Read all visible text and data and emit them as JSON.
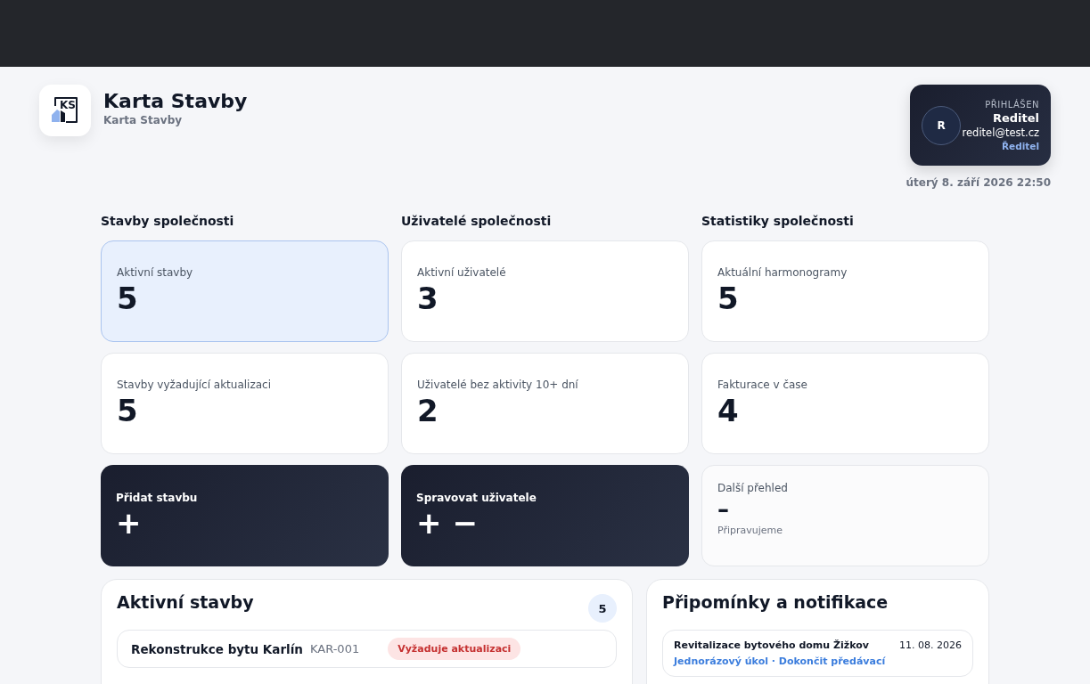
{
  "brand": {
    "logo": "KS",
    "title": "Karta Stavby",
    "subtitle": "Karta Stavby"
  },
  "user": {
    "avatar": "R",
    "label": "PŘIHLÁŠEN",
    "name": "Reditel",
    "email": "reditel@test.cz",
    "role": "Ředitel"
  },
  "datetime": "úterý 8. září 2026 22:50",
  "columns": [
    {
      "title": "Stavby společnosti",
      "cards": [
        {
          "kind": "stat",
          "label": "Aktivní stavby",
          "value": "5",
          "selected": true
        },
        {
          "kind": "stat",
          "label": "Stavby vyžadující aktualizaci",
          "value": "5",
          "selected": false
        },
        {
          "kind": "action",
          "label": "Přidat stavbu",
          "symbols": [
            "+"
          ]
        }
      ]
    },
    {
      "title": "Uživatelé společnosti",
      "cards": [
        {
          "kind": "stat",
          "label": "Aktivní uživatelé",
          "value": "3",
          "selected": false
        },
        {
          "kind": "stat",
          "label": "Uživatelé bez aktivity 10+ dní",
          "value": "2",
          "selected": false
        },
        {
          "kind": "action",
          "label": "Spravovat uživatele",
          "symbols": [
            "+",
            "−"
          ]
        }
      ]
    },
    {
      "title": "Statistiky společnosti",
      "cards": [
        {
          "kind": "stat",
          "label": "Aktuální harmonogramy",
          "value": "5",
          "selected": false
        },
        {
          "kind": "stat",
          "label": "Fakturace v čase",
          "value": "4",
          "selected": false
        },
        {
          "kind": "placeholder",
          "label": "Další přehled",
          "value": "–",
          "note": "Připravujeme"
        }
      ]
    }
  ],
  "active_projects": {
    "title": "Aktivní stavby",
    "count": "5",
    "rows": [
      {
        "name": "Rekonstrukce bytu Karlín",
        "code": "KAR-001",
        "badge": "Vyžaduje aktualizaci"
      }
    ]
  },
  "notifications": {
    "title": "Připomínky a notifikace",
    "items": [
      {
        "project": "Revitalizace bytového domu Žižkov",
        "date": "11. 08. 2026",
        "detail": "Jednorázový úkol · Dokončit předávací"
      }
    ]
  }
}
